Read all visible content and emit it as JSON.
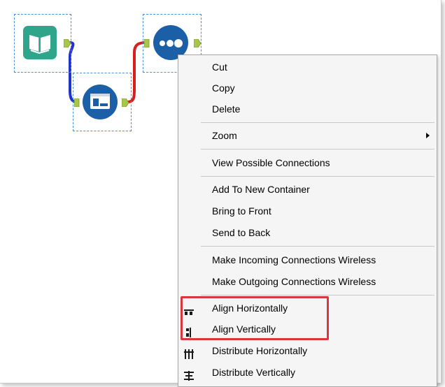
{
  "menu": {
    "items": [
      {
        "label": "Cut"
      },
      {
        "label": "Copy"
      },
      {
        "label": "Delete"
      },
      {
        "label": "Zoom"
      },
      {
        "label": "View Possible Connections"
      },
      {
        "label": "Add To New Container"
      },
      {
        "label": "Bring to Front"
      },
      {
        "label": "Send to Back"
      },
      {
        "label": "Make Incoming Connections Wireless"
      },
      {
        "label": "Make Outgoing Connections Wireless"
      },
      {
        "label": "Align Horizontally",
        "icon": "align-horizontal-icon"
      },
      {
        "label": "Align Vertically",
        "icon": "align-vertical-icon"
      },
      {
        "label": "Distribute Horizontally",
        "icon": "distribute-horizontal-icon"
      },
      {
        "label": "Distribute Vertically",
        "icon": "distribute-vertical-icon"
      }
    ],
    "submenu_on": "Zoom"
  },
  "canvas": {
    "tools": [
      {
        "name": "input-data-tool",
        "icon": "book-icon",
        "color": "#2fa58b"
      },
      {
        "name": "browse-tool",
        "icon": "browse-window-icon",
        "color": "#1b5fa6"
      },
      {
        "name": "union-tool",
        "icon": "three-dots-icon",
        "color": "#1b5fa6"
      }
    ],
    "connections": [
      {
        "from": "input-data-tool",
        "to": "browse-tool",
        "color": "#2233cc"
      },
      {
        "from": "browse-tool",
        "to": "union-tool",
        "color": "#d42020"
      }
    ],
    "anchor_color": "#a8c64a"
  },
  "highlight_color": "#d9363e"
}
